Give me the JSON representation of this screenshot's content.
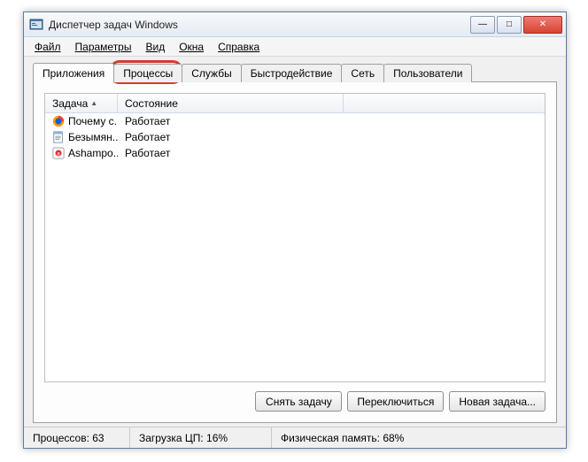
{
  "window": {
    "title": "Диспетчер задач Windows"
  },
  "menu": {
    "file": "Файл",
    "options": "Параметры",
    "view": "Вид",
    "windows": "Окна",
    "help": "Справка"
  },
  "tabs": {
    "applications": "Приложения",
    "processes": "Процессы",
    "services": "Службы",
    "performance": "Быстродействие",
    "networking": "Сеть",
    "users": "Пользователи"
  },
  "columns": {
    "task": "Задача",
    "state": "Состояние"
  },
  "rows": [
    {
      "icon": "firefox-icon",
      "task": "Почему с...",
      "state": "Работает"
    },
    {
      "icon": "notepad-icon",
      "task": "Безымян...",
      "state": "Работает"
    },
    {
      "icon": "ashampoo-icon",
      "task": "Ashampo...",
      "state": "Работает"
    }
  ],
  "buttons": {
    "end_task": "Снять задачу",
    "switch_to": "Переключиться",
    "new_task": "Новая задача..."
  },
  "status": {
    "processes": "Процессов: 63",
    "cpu": "Загрузка ЦП: 16%",
    "memory": "Физическая память: 68%"
  },
  "icons": {
    "minimize": "—",
    "maximize": "□",
    "close": "✕",
    "sort_asc": "▲"
  }
}
